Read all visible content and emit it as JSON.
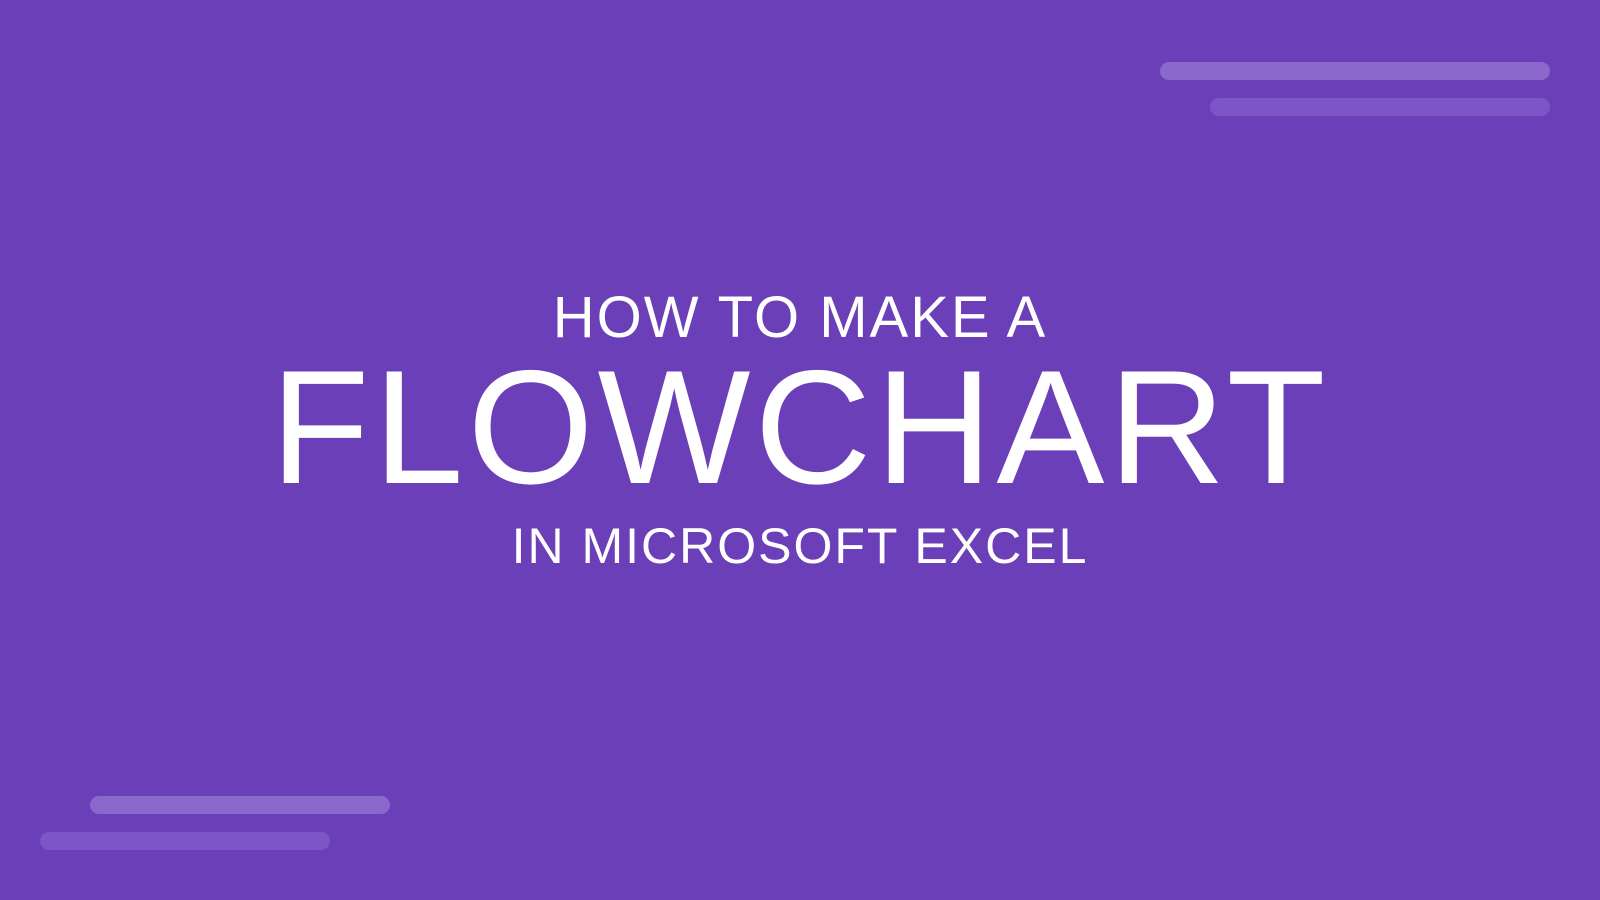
{
  "title": {
    "line_top": "HOW TO MAKE A",
    "line_main": "FLOWCHART",
    "line_bottom": "IN MICROSOFT EXCEL"
  }
}
